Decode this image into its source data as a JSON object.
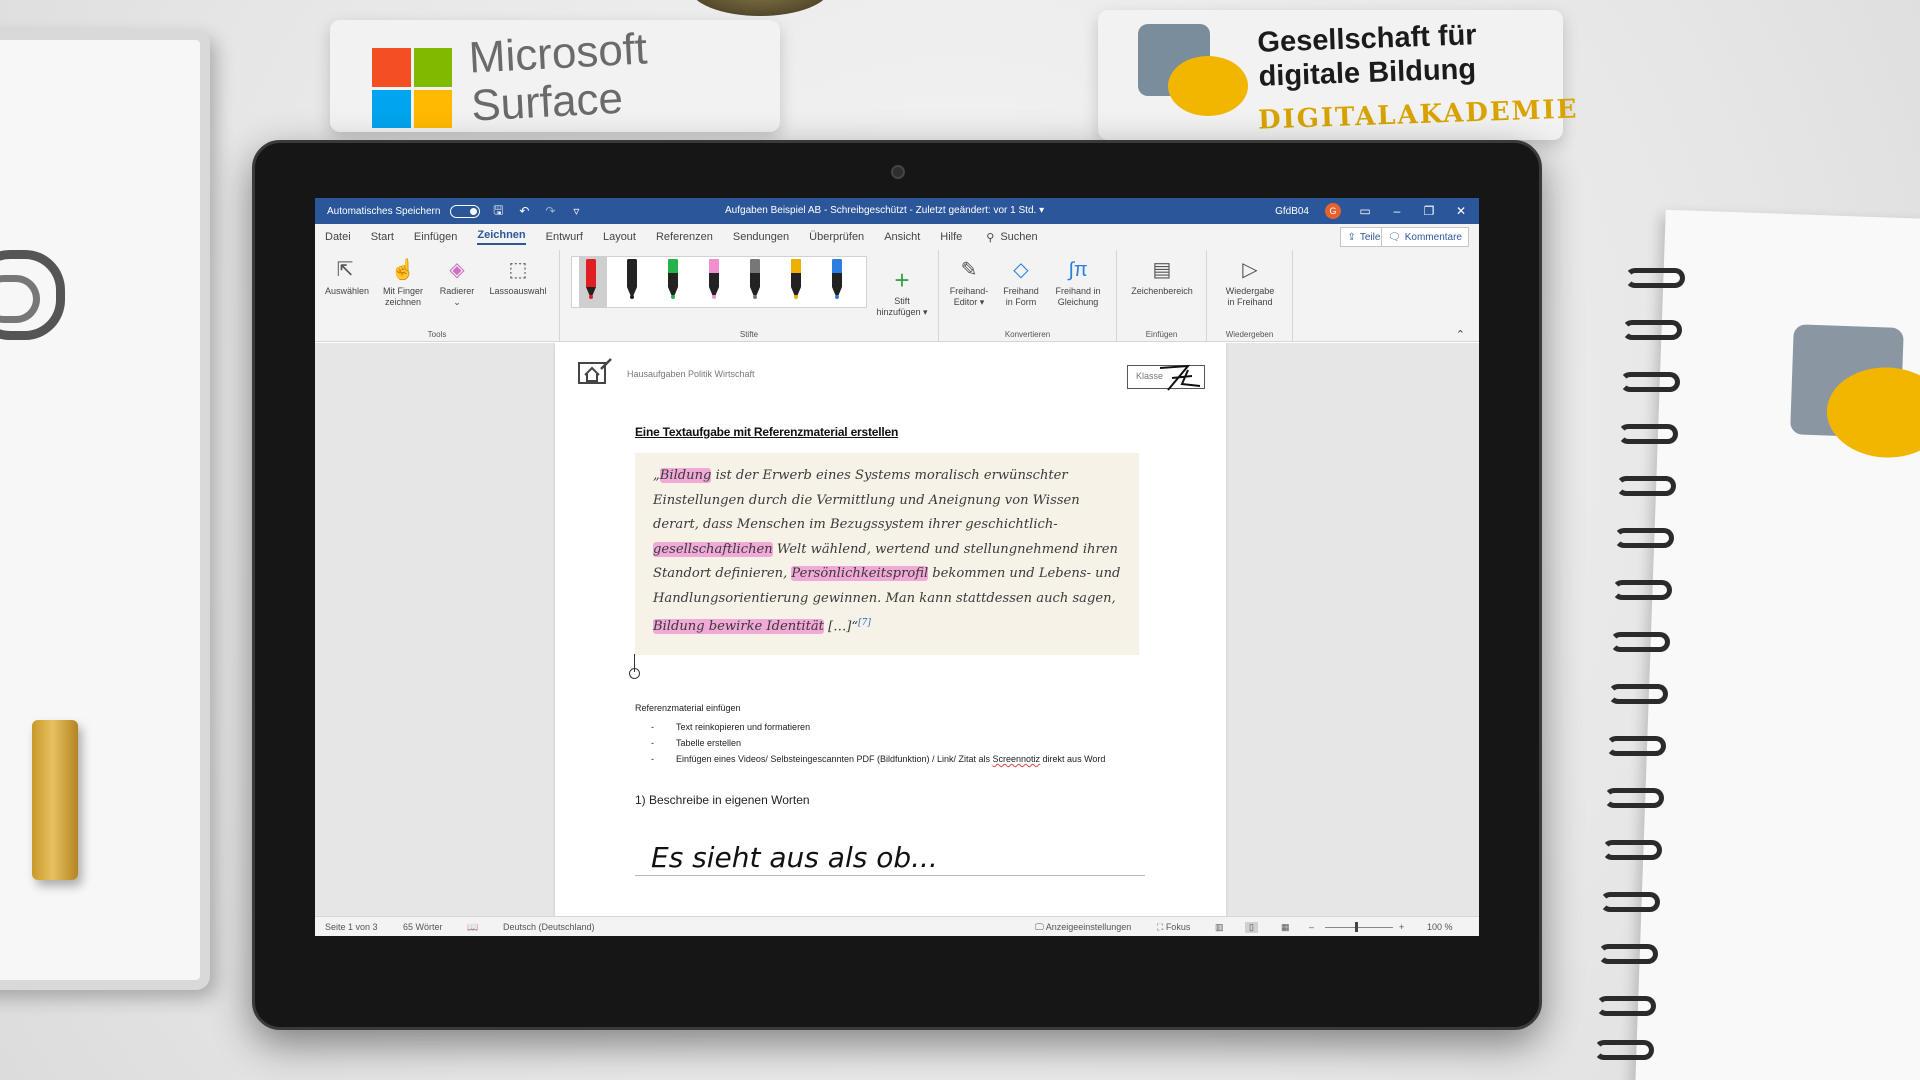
{
  "branding": {
    "microsoft": "Microsoft\nSurface",
    "gdb_line1": "Gesellschaft für",
    "gdb_line2": "digitale Bildung",
    "gdb_sub": "DIGITALAKADEMIE"
  },
  "titlebar": {
    "autosave_label": "Automatisches Speichern",
    "doc_title": "Aufgaben Beispiel AB  -  Schreibgeschützt  -  Zuletzt geändert: vor 1 Std.  ▾",
    "user": "GfdB04",
    "user_initial": "G"
  },
  "menu": {
    "tabs": [
      "Datei",
      "Start",
      "Einfügen",
      "Zeichnen",
      "Entwurf",
      "Layout",
      "Referenzen",
      "Sendungen",
      "Überprüfen",
      "Ansicht",
      "Hilfe"
    ],
    "active_tab": "Zeichnen",
    "search_label": "Suchen",
    "share_label": "Teilen",
    "comments_label": "Kommentare"
  },
  "ribbon": {
    "tools": {
      "select": "Auswählen",
      "finger_line1": "Mit Finger",
      "finger_line2": "zeichnen",
      "eraser": "Radierer",
      "lasso": "Lassoauswahl",
      "group": "Tools"
    },
    "pens": {
      "colors": [
        "#e02020",
        "#222222",
        "#26b34a",
        "#f090d0",
        "#777777",
        "#f0b000",
        "#2a7fe0"
      ],
      "add_line1": "Stift",
      "add_line2": "hinzufügen ▾",
      "group": "Stifte"
    },
    "convert": {
      "editor_line1": "Freihand-",
      "editor_line2": "Editor ▾",
      "shape_line1": "Freihand",
      "shape_line2": "in Form",
      "math_line1": "Freihand in",
      "math_line2": "Gleichung",
      "group": "Konvertieren"
    },
    "insert": {
      "canvas": "Zeichenbereich",
      "group": "Einfügen"
    },
    "replay": {
      "line1": "Wiedergabe",
      "line2": "in Freihand",
      "group": "Wiedergeben"
    }
  },
  "document": {
    "header_text": "Hausaufgaben Politik Wirtschaft",
    "klasse_label": "Klasse",
    "title": "Eine Textaufgabe mit Referenzmaterial erstellen",
    "quote": {
      "p1": "„",
      "h1": "Bildung",
      "p2": " ist der Erwerb eines Systems moralisch erwünschter Einstellungen durch die Vermittlung und Aneignung von Wissen derart, dass Menschen im Bezugssystem ihrer geschichtlich-",
      "h2": "gesellschaftlichen",
      "p3": " Welt wählend, wertend und stellungnehmend ihren Standort definieren, ",
      "h3": "Persönlichkeitsprofil",
      "p4": " bekommen und Lebens- und Handlungsorientierung gewinnen. Man kann stattdessen auch sagen, ",
      "h4": "Bildung bewirke Identität",
      "p5": " […]“",
      "footnote": "[7]"
    },
    "section_label": "Referenzmaterial einfügen",
    "bullets": [
      "Text reinkopieren und formatieren",
      "Tabelle erstellen"
    ],
    "bullet3_pre": "Einfügen eines Videos/ Selbsteingescannten PDF (Bildfunktion) / Link/ Zitat als ",
    "bullet3_word": "Screennotiz",
    "bullet3_post": " direkt aus Word",
    "question": "1) Beschreibe in eigenen Worten",
    "handwriting": "Es sieht aus als ob..."
  },
  "statusbar": {
    "page": "Seite 1 von 3",
    "words": "65 Wörter",
    "language": "Deutsch (Deutschland)",
    "display": "Anzeigeeinstellungen",
    "focus": "Fokus",
    "zoom": "100 %"
  }
}
